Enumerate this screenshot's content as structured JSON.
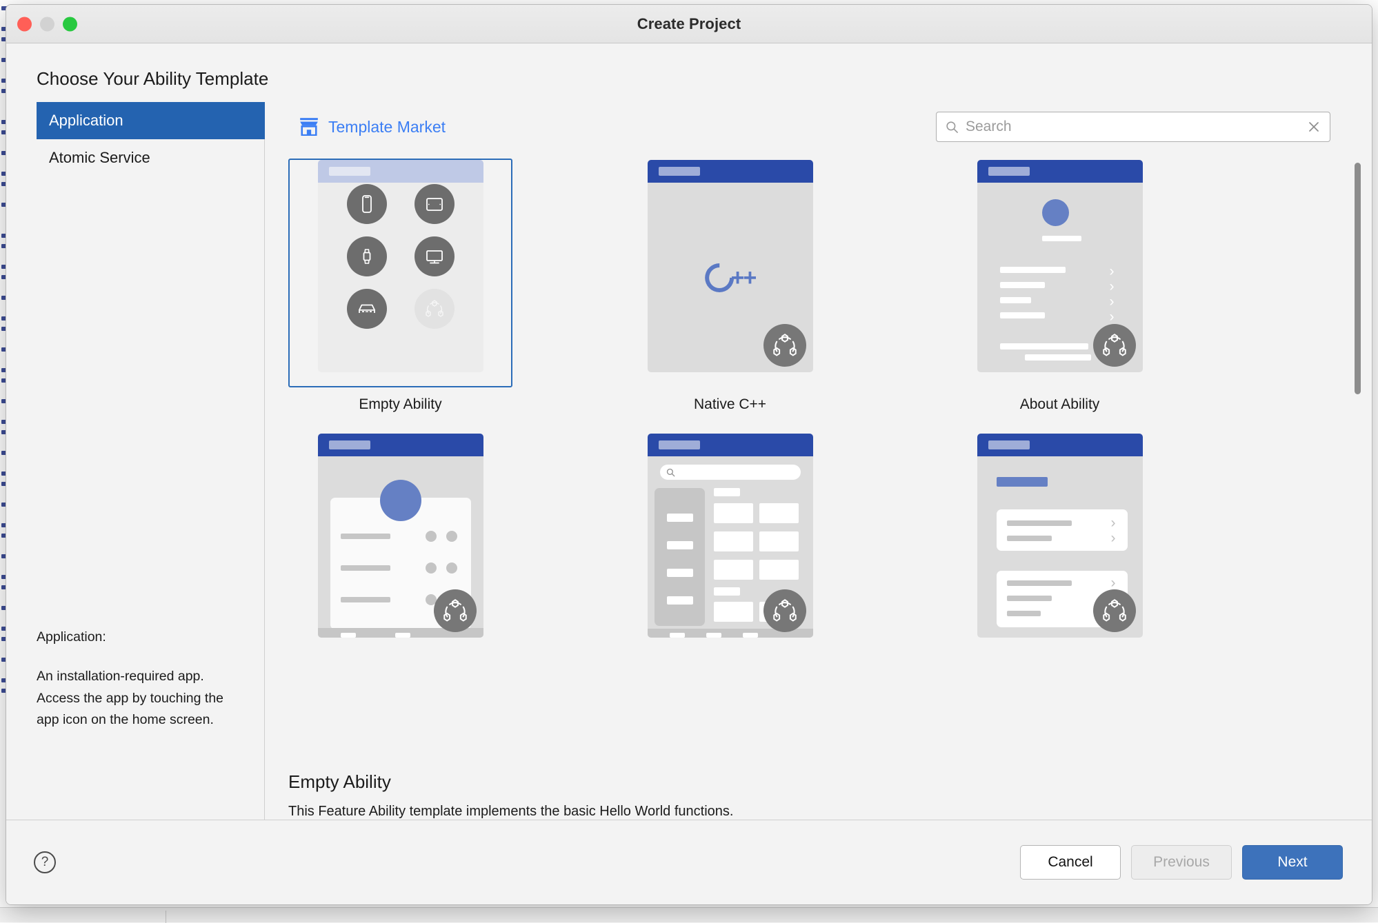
{
  "window": {
    "title": "Create Project",
    "traffic_lights": [
      "close",
      "minimize",
      "maximize"
    ]
  },
  "page": {
    "heading": "Choose Your Ability Template"
  },
  "sidebar": {
    "items": [
      {
        "label": "Application",
        "selected": true
      },
      {
        "label": "Atomic Service",
        "selected": false
      }
    ],
    "description": {
      "label": "Application:",
      "text": "An installation-required app. Access the app by touching the app icon on the home screen."
    }
  },
  "toolbar": {
    "market_label": "Template Market",
    "market_icon": "storefront-icon",
    "search": {
      "placeholder": "Search",
      "value": "",
      "search_icon": "search-icon",
      "clear_icon": "close-icon"
    }
  },
  "templates": [
    {
      "label": "Empty Ability",
      "preview": "devices",
      "selected": true
    },
    {
      "label": "Native C++",
      "preview": "cpp",
      "selected": false
    },
    {
      "label": "About Ability",
      "preview": "about",
      "selected": false
    },
    {
      "label": "",
      "preview": "profile",
      "selected": false
    },
    {
      "label": "",
      "preview": "catalog",
      "selected": false
    },
    {
      "label": "",
      "preview": "settings",
      "selected": false
    }
  ],
  "details": {
    "title": "Empty Ability",
    "text": "This Feature Ability template implements the basic Hello World functions."
  },
  "footer": {
    "help_icon": "help-icon",
    "help_label": "?",
    "cancel_label": "Cancel",
    "previous_label": "Previous",
    "next_label": "Next"
  },
  "colors": {
    "accent": "#2463b0",
    "primary_button": "#3d72bb",
    "link": "#3b7ef4",
    "selection_border": "#2b6cb8",
    "preview_header": "#2a4aa8"
  }
}
